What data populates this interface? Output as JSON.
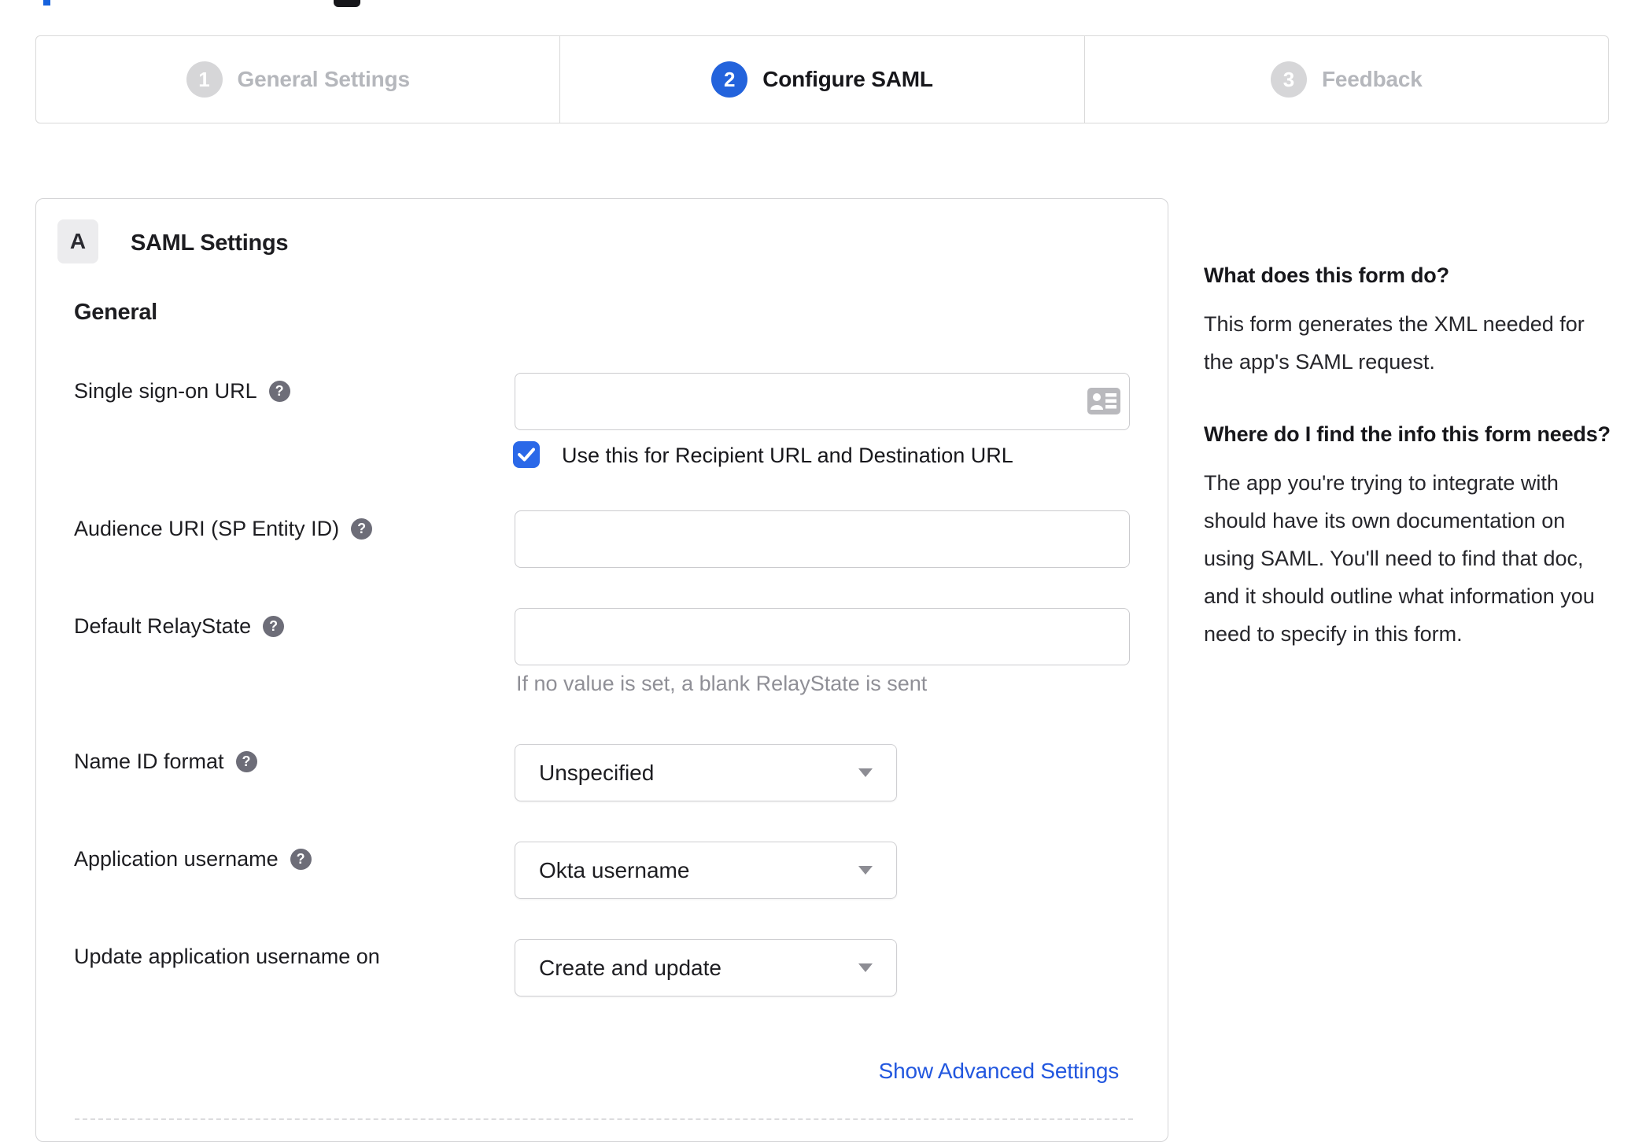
{
  "stepper": {
    "steps": [
      {
        "number": "1",
        "label": "General Settings",
        "state": "inactive"
      },
      {
        "number": "2",
        "label": "Configure SAML",
        "state": "active"
      },
      {
        "number": "3",
        "label": "Feedback",
        "state": "inactive"
      }
    ]
  },
  "card": {
    "badge": "A",
    "title": "SAML Settings",
    "section_heading": "General"
  },
  "form": {
    "sso": {
      "label": "Single sign-on URL",
      "value": "",
      "checkbox_label": "Use this for Recipient URL and Destination URL",
      "checkbox_checked": true
    },
    "audience": {
      "label": "Audience URI (SP Entity ID)",
      "value": ""
    },
    "relay": {
      "label": "Default RelayState",
      "value": "",
      "note": "If no value is set, a blank RelayState is sent"
    },
    "nameid": {
      "label": "Name ID format",
      "value": "Unspecified"
    },
    "appuser": {
      "label": "Application username",
      "value": "Okta username"
    },
    "updateuser": {
      "label": "Update application username on",
      "value": "Create and update"
    },
    "advanced_link": "Show Advanced Settings"
  },
  "help": {
    "q1": "What does this form do?",
    "a1": "This form generates the XML needed for the app's SAML request.",
    "q2": "Where do I find the info this form needs?",
    "a2": "The app you're trying to integrate with should have its own documentation on using SAML. You'll need to find that doc, and it should outline what information you need to specify in this form."
  },
  "colors": {
    "accent_blue": "#2363dc",
    "link_blue": "#2257df",
    "checkbox_blue": "#2a68e8",
    "inactive_gray": "#b5b7bc",
    "border_gray": "#d4d4d6",
    "help_icon_gray": "#6d6d78"
  }
}
